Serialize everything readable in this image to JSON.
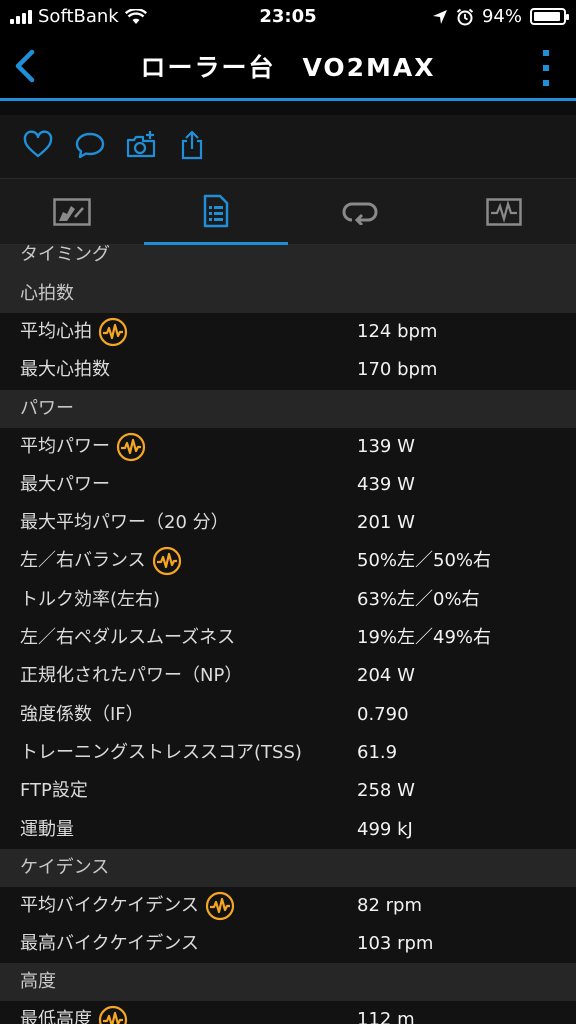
{
  "status_bar": {
    "carrier": "SoftBank",
    "time": "23:05",
    "battery": "94%",
    "battery_level": 94
  },
  "nav": {
    "title": "ローラー台　VO2MAX"
  },
  "actions": [
    "heart-icon",
    "comment-icon",
    "camera-add-icon",
    "share-icon"
  ],
  "tabs": [
    "map-tab",
    "stats-tab",
    "laps-tab",
    "chart-tab"
  ],
  "active_tab": "stats-tab",
  "accent_color": "#1f8fd8",
  "badge_color": "#f5a623",
  "content": {
    "partial_header": "タイミング",
    "sections": [
      {
        "title": "心拍数",
        "rows": [
          {
            "label": "平均心拍",
            "value": "124 bpm",
            "badge": true
          },
          {
            "label": "最大心拍数",
            "value": "170 bpm",
            "badge": false
          }
        ]
      },
      {
        "title": "パワー",
        "rows": [
          {
            "label": "平均パワー",
            "value": "139 W",
            "badge": true
          },
          {
            "label": "最大パワー",
            "value": "439 W",
            "badge": false
          },
          {
            "label": "最大平均パワー（20 分）",
            "value": "201 W",
            "badge": false
          },
          {
            "label": "左／右バランス",
            "value": "50%左／50%右",
            "badge": true
          },
          {
            "label": "トルク効率(左右)",
            "value": "63%左／0%右",
            "badge": false
          },
          {
            "label": "左／右ペダルスムーズネス",
            "value": "19%左／49%右",
            "badge": false
          },
          {
            "label": "正規化されたパワー（NP）",
            "value": "204 W",
            "badge": false
          },
          {
            "label": "強度係数（IF）",
            "value": "0.790",
            "badge": false
          },
          {
            "label": "トレーニングストレススコア(TSS)",
            "value": "61.9",
            "badge": false
          },
          {
            "label": "FTP設定",
            "value": "258 W",
            "badge": false
          },
          {
            "label": "運動量",
            "value": "499 kJ",
            "badge": false
          }
        ]
      },
      {
        "title": "ケイデンス",
        "rows": [
          {
            "label": "平均バイクケイデンス",
            "value": "82 rpm",
            "badge": true
          },
          {
            "label": "最高バイクケイデンス",
            "value": "103 rpm",
            "badge": false
          }
        ]
      },
      {
        "title": "高度",
        "rows": [
          {
            "label": "最低高度",
            "value": "112 m",
            "badge": true
          }
        ]
      }
    ]
  }
}
